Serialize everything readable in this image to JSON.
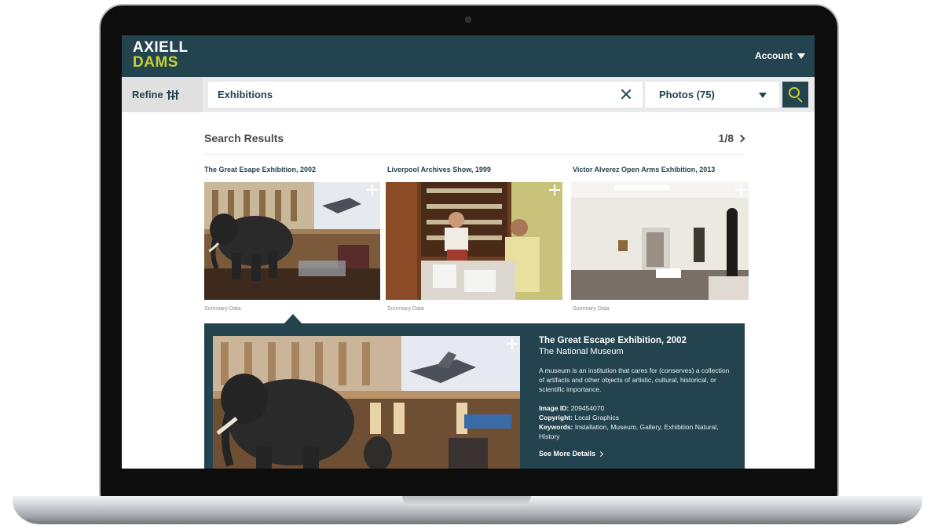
{
  "brand": {
    "line1": "AXIELL",
    "line2": "DAMS"
  },
  "header": {
    "account_label": "Account"
  },
  "searchbar": {
    "refine_label": "Refine",
    "query": "Exhibitions",
    "filter_selected": "Photos (75)"
  },
  "results": {
    "title": "Search Results",
    "page": "1/8",
    "items": [
      {
        "title": "The Great Esape Exhibition, 2002",
        "summary": "Summary Data"
      },
      {
        "title": "Liverpool Archives Show, 1999",
        "summary": "Summary Data"
      },
      {
        "title": "Victor Alverez Open Arms Exhibition, 2013",
        "summary": "Summary Data"
      }
    ]
  },
  "detail": {
    "title": "The Great Escape Exhibition, 2002",
    "subtitle": "The National Museum",
    "description": "A museum is an institution that cares for (conserves) a collection of artifacts and other objects of artistic, cultural, historical, or scientific importance.",
    "image_id_label": "Image ID:",
    "image_id": "209454070",
    "copyright_label": "Copyright:",
    "copyright": "Local Graphics",
    "keywords_label": "Keywords:",
    "keywords": "Installation, Museum, Gallery, Exhibition Natural, History",
    "see_more": "See More Details"
  },
  "colors": {
    "primary": "#23444f",
    "accent": "#c6cf35",
    "bar_bg": "#e9eaea"
  },
  "icons": [
    "sliders-icon",
    "close-icon",
    "chevron-down-icon",
    "search-icon",
    "plus-icon",
    "chevron-right-icon"
  ]
}
